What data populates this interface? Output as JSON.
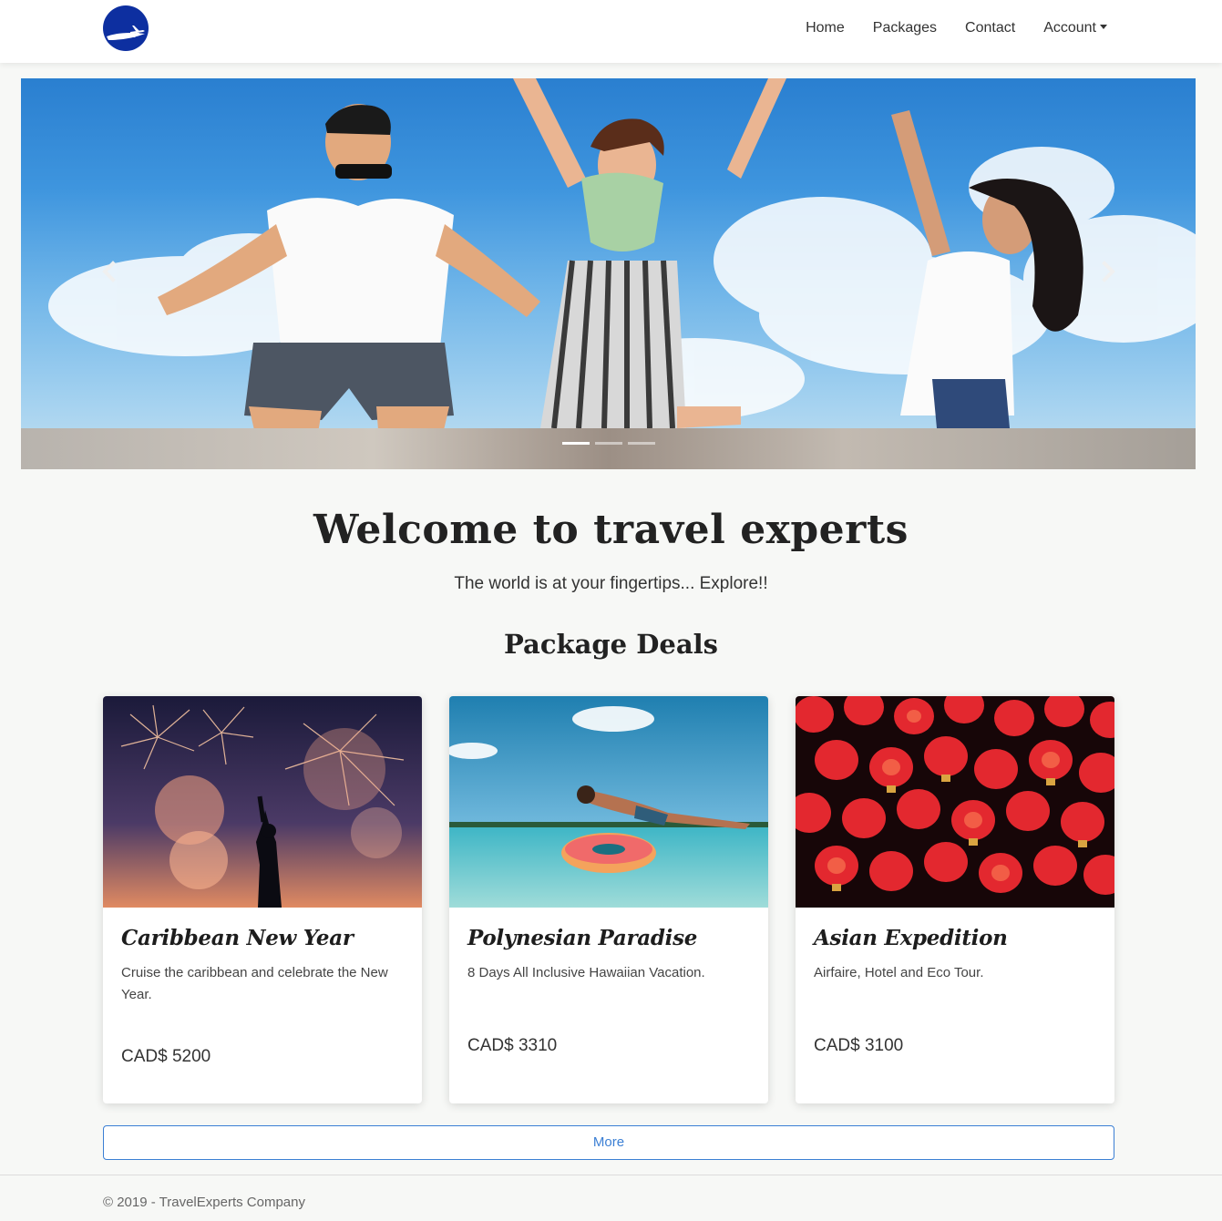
{
  "nav": {
    "logo": "plane-globe-logo",
    "links": [
      "Home",
      "Packages",
      "Contact",
      "Account"
    ]
  },
  "carousel": {
    "slides": 3,
    "active_slide": 1,
    "prev_icon": "chevron-left-icon",
    "next_icon": "chevron-right-icon"
  },
  "hero": {
    "title": "Welcome to travel experts",
    "tagline": "The world is at your fingertips... Explore!!"
  },
  "deals": {
    "title": "Package Deals",
    "packages": [
      {
        "name": "Caribbean New Year",
        "description": "Cruise the caribbean and celebrate the New Year.",
        "price": "CAD$ 5200"
      },
      {
        "name": "Polynesian Paradise",
        "description": "8 Days All Inclusive Hawaiian Vacation.",
        "price": "CAD$ 3310"
      },
      {
        "name": "Asian Expedition",
        "description": "Airfaire, Hotel and Eco Tour.",
        "price": "CAD$ 3100"
      }
    ],
    "more_label": "More"
  },
  "footer": {
    "text": "© 2019 - TravelExperts Company"
  },
  "colors": {
    "brand_blue": "#0d2fa0",
    "link_blue": "#3b7fd4"
  }
}
